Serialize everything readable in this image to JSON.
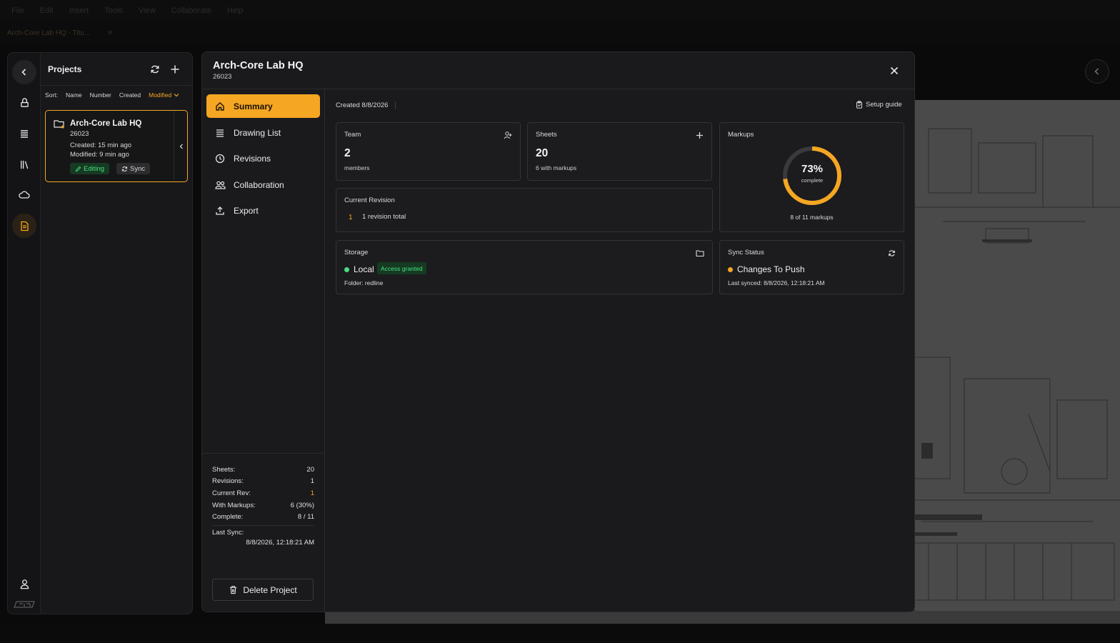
{
  "background": {
    "menu": [
      "File",
      "Edit",
      "Insert",
      "Tools",
      "View",
      "Collaborate",
      "Help"
    ],
    "tab_label": "Arch-Core Lab HQ - Titu..."
  },
  "colors": {
    "accent": "#f5a623",
    "success": "#4ade80",
    "panel": "#1a1a1c"
  },
  "projects_panel": {
    "title": "Projects",
    "sort": {
      "label": "Sort:",
      "options": [
        "Name",
        "Number",
        "Created",
        "Modified"
      ],
      "active": "Modified"
    },
    "card": {
      "name": "Arch-Core Lab HQ",
      "number": "26023",
      "created": "Created: 15 min ago",
      "modified": "Modified: 9 min ago",
      "badge_editing": "Editing",
      "badge_sync": "Sync"
    }
  },
  "modal": {
    "title": "Arch-Core Lab HQ",
    "subtitle": "26023",
    "nav": [
      {
        "label": "Summary",
        "icon": "home-icon",
        "active": true
      },
      {
        "label": "Drawing List",
        "icon": "list-icon",
        "active": false
      },
      {
        "label": "Revisions",
        "icon": "clock-icon",
        "active": false
      },
      {
        "label": "Collaboration",
        "icon": "users-icon",
        "active": false
      },
      {
        "label": "Export",
        "icon": "upload-icon",
        "active": false
      }
    ],
    "stats": {
      "sheets_label": "Sheets:",
      "sheets": "20",
      "revisions_label": "Revisions:",
      "revisions": "1",
      "current_rev_label": "Current Rev:",
      "current_rev": "1",
      "with_markups_label": "With Markups:",
      "with_markups": "6 (30%)",
      "complete_label": "Complete:",
      "complete": "8 / 11",
      "last_sync_label": "Last Sync:",
      "last_sync": "8/8/2026, 12:18:21 AM"
    },
    "delete_label": "Delete Project",
    "summary": {
      "created": "Created 8/8/2026",
      "setup_guide": "Setup guide",
      "team": {
        "label": "Team",
        "value": "2",
        "sub": "members"
      },
      "sheets": {
        "label": "Sheets",
        "value": "20",
        "sub": "6 with markups"
      },
      "markups": {
        "label": "Markups",
        "percent_text": "73%",
        "percent": 0.73,
        "complete_label": "complete",
        "footer": "8 of 11 markups"
      },
      "current_revision": {
        "label": "Current Revision",
        "number": "1",
        "text": "1 revision total"
      },
      "storage": {
        "label": "Storage",
        "type": "Local",
        "access": "Access granted",
        "folder": "Folder: redline"
      },
      "sync_status": {
        "label": "Sync Status",
        "state": "Changes To Push",
        "last_synced": "Last synced: 8/8/2026, 12:18:21 AM"
      }
    }
  }
}
